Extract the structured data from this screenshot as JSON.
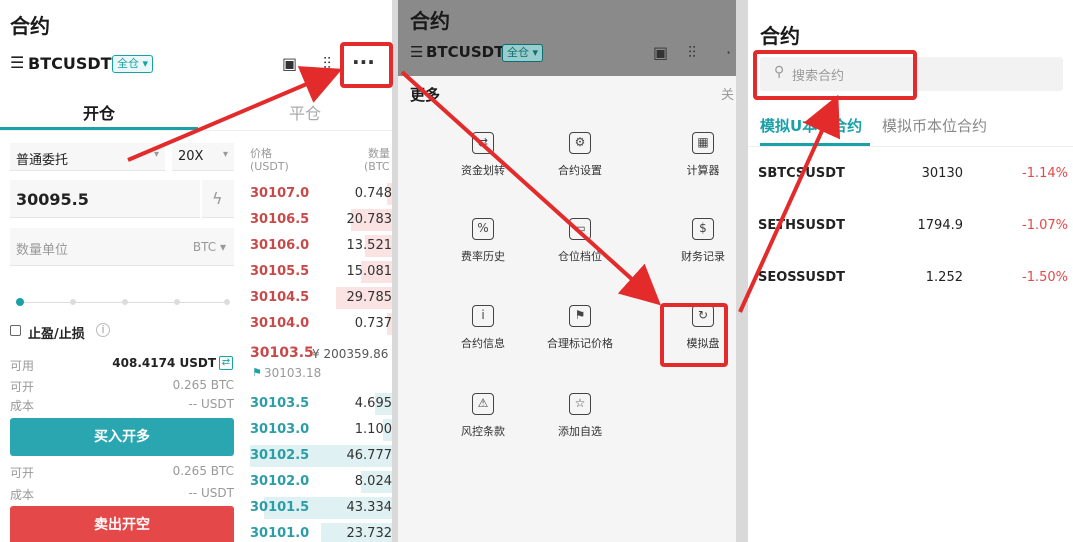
{
  "panel1": {
    "title": "合约",
    "symbol": "BTCUSDT",
    "margin_mode": "全仓 ▾",
    "more_label": "···",
    "tabs": [
      "开仓",
      "平仓"
    ],
    "order_type": "普通委托",
    "leverage": "20X",
    "price_value": "30095.5",
    "qty_placeholder": "数量单位",
    "qty_unit": "BTC ▾",
    "tp_sl_label": "止盈/止损",
    "available_label": "可用",
    "available_value": "408.4174 USDT",
    "open_label": "可开",
    "open_value": "0.265 BTC",
    "cost_label": "成本",
    "cost_value": "-- USDT",
    "buy_button": "买入开多",
    "open_label2": "可开",
    "open_value2": "0.265 BTC",
    "cost_label2": "成本",
    "cost_value2": "-- USDT",
    "sell_button": "卖出开空",
    "orderbook": {
      "price_header": "价格",
      "price_unit": "(USDT)",
      "qty_header": "数量",
      "qty_unit": "(BTC",
      "asks": [
        {
          "price": "30107.0",
          "qty": "0.748",
          "depth": 0.05
        },
        {
          "price": "30106.5",
          "qty": "20.783",
          "depth": 0.45
        },
        {
          "price": "30106.0",
          "qty": "13.521",
          "depth": 0.3
        },
        {
          "price": "30105.5",
          "qty": "15.081",
          "depth": 0.35
        },
        {
          "price": "30104.5",
          "qty": "29.785",
          "depth": 0.62
        },
        {
          "price": "30104.0",
          "qty": "0.737",
          "depth": 0.05
        }
      ],
      "last_price": "30103.5",
      "last_fiat": "¥ 200359.86",
      "mark_price": "30103.18",
      "bids": [
        {
          "price": "30103.5",
          "qty": "4.695",
          "depth": 0.12
        },
        {
          "price": "30103.0",
          "qty": "1.100",
          "depth": 0.06
        },
        {
          "price": "30102.5",
          "qty": "46.777",
          "depth": 1.0
        },
        {
          "price": "30102.0",
          "qty": "8.024",
          "depth": 0.22
        },
        {
          "price": "30101.5",
          "qty": "43.334",
          "depth": 0.9
        },
        {
          "price": "30101.0",
          "qty": "23.732",
          "depth": 0.5
        }
      ]
    }
  },
  "panel2": {
    "title": "合约",
    "symbol": "BTCUSDT",
    "margin_mode": "全仓 ▾",
    "more_title": "更多",
    "close_label": "关",
    "items": [
      {
        "label": "资金划转",
        "icon": "⇄"
      },
      {
        "label": "合约设置",
        "icon": "⚙"
      },
      {
        "label": "计算器",
        "icon": "▦"
      },
      {
        "label": "费率历史",
        "icon": "%"
      },
      {
        "label": "仓位档位",
        "icon": "▭"
      },
      {
        "label": "财务记录",
        "icon": "$"
      },
      {
        "label": "合约信息",
        "icon": "i"
      },
      {
        "label": "合理标记价格",
        "icon": "⚑"
      },
      {
        "label": "模拟盘",
        "icon": "↻"
      },
      {
        "label": "风控条款",
        "icon": "⚠"
      },
      {
        "label": "添加自选",
        "icon": "☆"
      }
    ]
  },
  "panel3": {
    "title": "合约",
    "search_placeholder": "搜索合约",
    "tabs": [
      "模拟U本位合约",
      "模拟币本位合约"
    ],
    "rows": [
      {
        "symbol": "SBTCSUSDT",
        "price": "30130",
        "change": "-1.14%"
      },
      {
        "symbol": "SETHSUSDT",
        "price": "1794.9",
        "change": "-1.07%"
      },
      {
        "symbol": "SEOSSUSDT",
        "price": "1.252",
        "change": "-1.50%"
      }
    ]
  },
  "colors": {
    "accent": "#1aa1a8",
    "buy": "#2aa6b0",
    "sell": "#e54848",
    "ask": "#c74a4a",
    "highlight": "#e32b2b"
  }
}
